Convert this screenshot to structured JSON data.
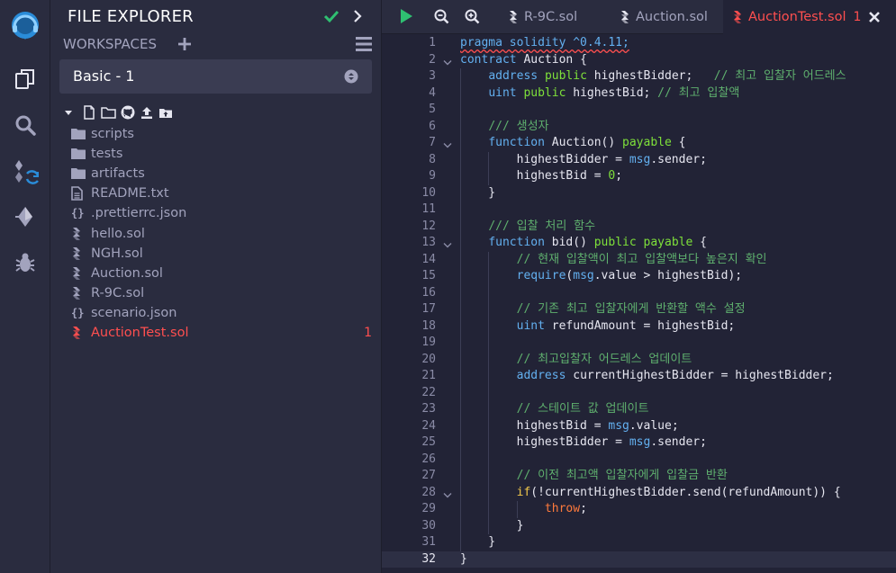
{
  "sidebar": {
    "title": "FILE EXPLORER",
    "workspaces_label": "WORKSPACES",
    "workspace_selected": "Basic - 1",
    "rail_icons": [
      "remix-logo-icon",
      "file-explorer-icon",
      "search-icon",
      "compiler-icon",
      "deploy-icon",
      "debugger-icon"
    ],
    "files": [
      {
        "name": "scripts",
        "icon": "folder-icon",
        "badge": ""
      },
      {
        "name": "tests",
        "icon": "folder-icon",
        "badge": ""
      },
      {
        "name": "artifacts",
        "icon": "folder-icon",
        "badge": ""
      },
      {
        "name": "README.txt",
        "icon": "text-file-icon",
        "badge": ""
      },
      {
        "name": ".prettierrc.json",
        "icon": "json-file-icon",
        "badge": ""
      },
      {
        "name": "hello.sol",
        "icon": "solidity-file-icon",
        "badge": ""
      },
      {
        "name": "NGH.sol",
        "icon": "solidity-file-icon",
        "badge": ""
      },
      {
        "name": "Auction.sol",
        "icon": "solidity-file-icon",
        "badge": ""
      },
      {
        "name": "R-9C.sol",
        "icon": "solidity-file-icon",
        "badge": ""
      },
      {
        "name": "scenario.json",
        "icon": "json-file-icon",
        "badge": ""
      },
      {
        "name": "AuctionTest.sol",
        "icon": "solidity-file-icon",
        "badge": "1"
      }
    ]
  },
  "editor": {
    "tabs": [
      {
        "label": "R-9C.sol",
        "active": false,
        "badge": ""
      },
      {
        "label": "Auction.sol",
        "active": false,
        "badge": ""
      },
      {
        "label": "AuctionTest.sol",
        "active": true,
        "badge": "1"
      }
    ],
    "current_line": 32,
    "lines": [
      "pragma solidity ^0.4.11;",
      "contract Auction {",
      "    address public highestBidder;   // 최고 입찰자 어드레스",
      "    uint public highestBid; // 최고 입찰액",
      "",
      "    /// 생성자",
      "    function Auction() payable {",
      "        highestBidder = msg.sender;",
      "        highestBid = 0;",
      "    }",
      "",
      "    /// 입찰 처리 함수",
      "    function bid() public payable {",
      "        // 현재 입찰액이 최고 입찰액보다 높은지 확인",
      "        require(msg.value > highestBid);",
      "",
      "        // 기존 최고 입찰자에게 반환할 액수 설정",
      "        uint refundAmount = highestBid;",
      "",
      "        // 최고입찰자 어드레스 업데이트",
      "        address currentHighestBidder = highestBidder;",
      "",
      "        // 스테이트 값 업데이트",
      "        highestBid = msg.value;",
      "        highestBidder = msg.sender;",
      "",
      "        // 이전 최고액 입찰자에게 입찰금 반환",
      "        if(!currentHighestBidder.send(refundAmount)) {",
      "            throw;",
      "        }",
      "    }",
      "}"
    ]
  }
}
